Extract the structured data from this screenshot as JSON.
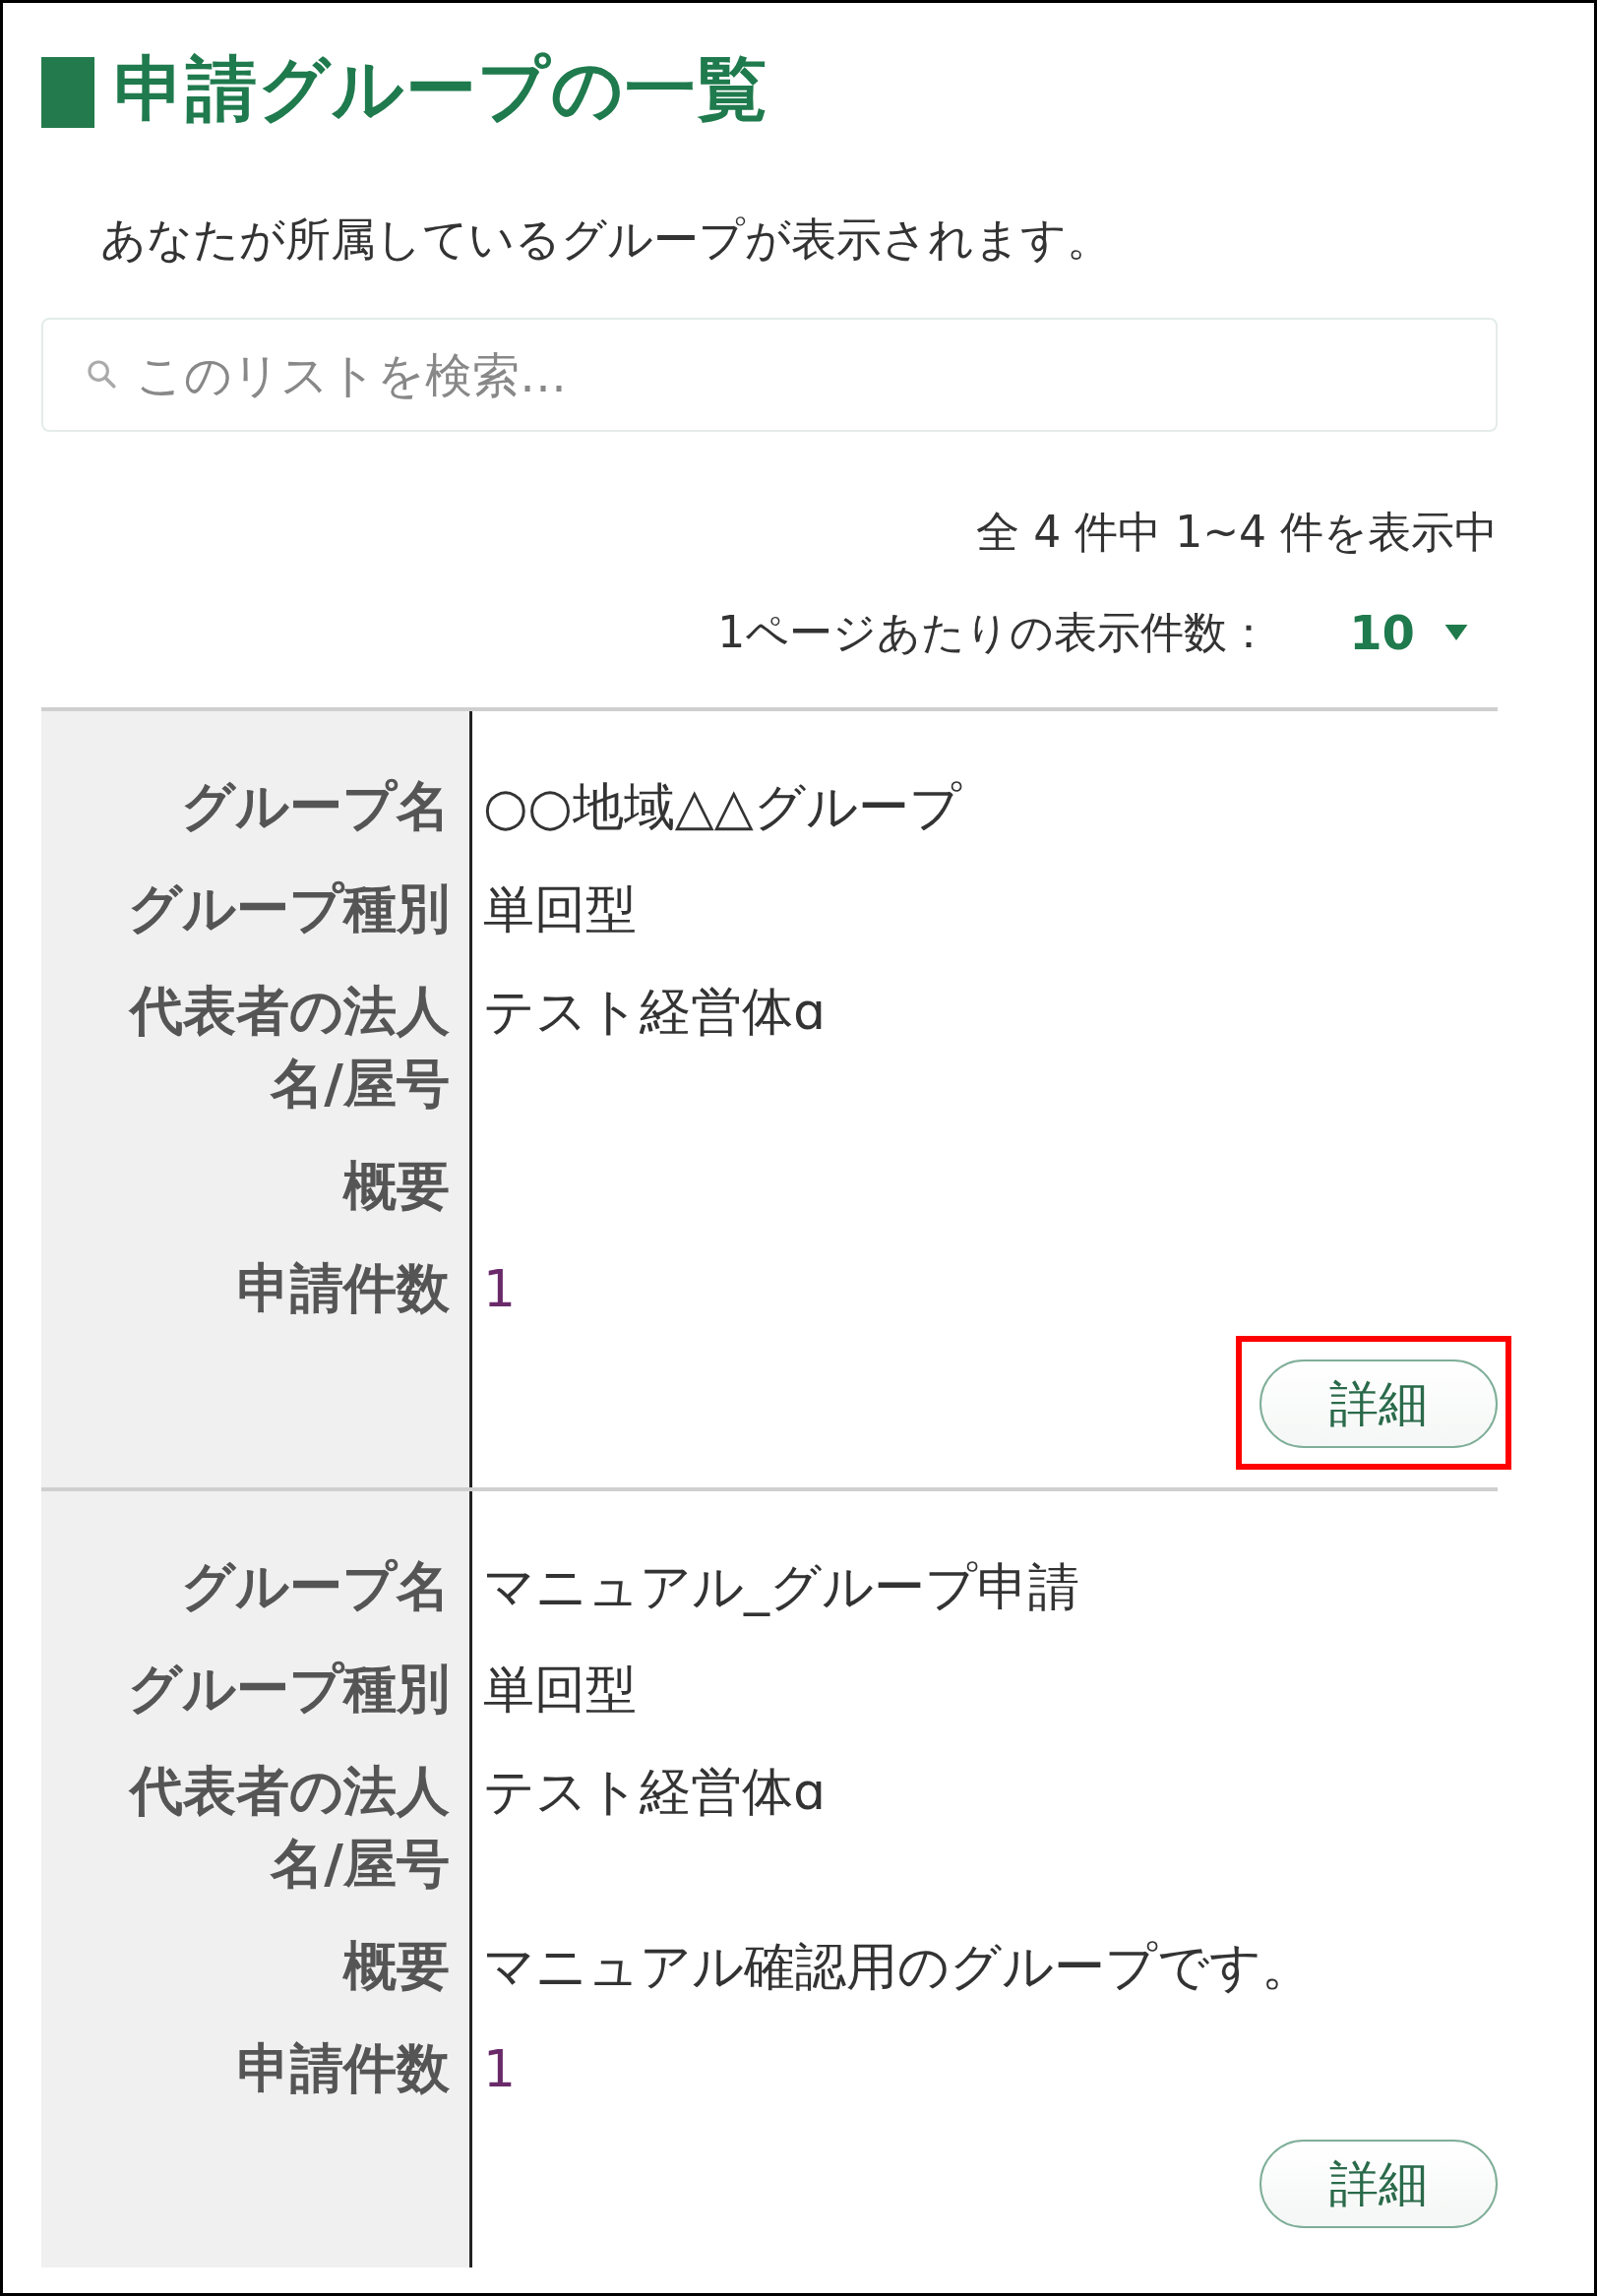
{
  "title": "申請グループの一覧",
  "description": "あなたが所属しているグループが表示されます。",
  "search": {
    "placeholder": "このリストを検索…"
  },
  "summary": "全 4 件中 1~4 件を表示中",
  "per_page": {
    "label": "1ページあたりの表示件数：",
    "value": "10"
  },
  "groups": [
    {
      "highlighted": true,
      "button": "詳細",
      "fields": [
        {
          "kind": "text",
          "label": "グループ名",
          "value": "○○地域△△グループ"
        },
        {
          "kind": "text",
          "label": "グループ種別",
          "value": "単回型"
        },
        {
          "kind": "text",
          "label": "代表者の法人名/屋号",
          "value": "テスト経営体ɑ"
        },
        {
          "label": "概要"
        },
        {
          "kind": "count",
          "label": "申請件数",
          "value": "1"
        }
      ]
    },
    {
      "highlighted": false,
      "button": "詳細",
      "fields": [
        {
          "kind": "text",
          "label": "グループ名",
          "value": "マニュアル_グループ申請"
        },
        {
          "kind": "text",
          "label": "グループ種別",
          "value": "単回型"
        },
        {
          "kind": "text",
          "label": "代表者の法人名/屋号",
          "value": "テスト経営体ɑ"
        },
        {
          "kind": "text",
          "label": "概要",
          "value": "マニュアル確認用のグループです。"
        },
        {
          "kind": "count",
          "label": "申請件数",
          "value": "1"
        }
      ]
    }
  ]
}
